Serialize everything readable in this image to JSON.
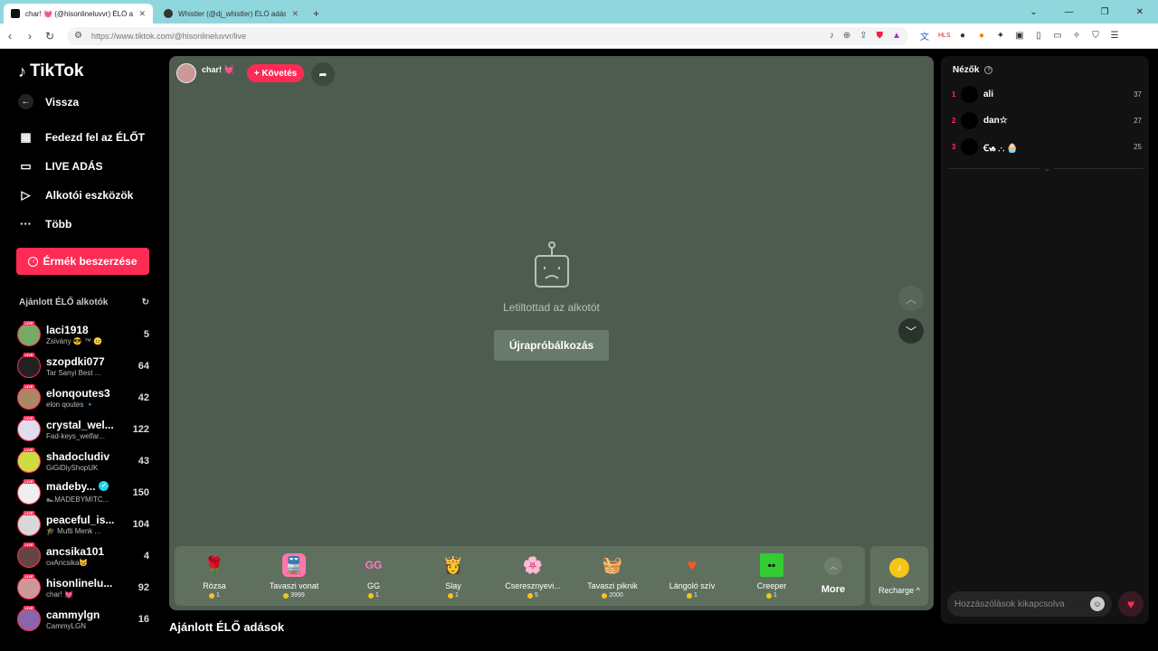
{
  "browser": {
    "tabs": [
      {
        "title": "char! 💓 (@hisonlineluvvr) ÉLŐ a...",
        "active": true
      },
      {
        "title": "Whistler (@dj_whistler) ÉLŐ adásban",
        "active": false
      }
    ],
    "url": "https://www.tiktok.com/@hisonlineluvvr/live"
  },
  "sidebar": {
    "logo": "TikTok",
    "back": "Vissza",
    "nav": [
      "Fedezd fel az ÉLŐT",
      "LIVE ADÁS",
      "Alkotói eszközök",
      "Több"
    ],
    "coins_button": "Érmék beszerzése",
    "recommended_title": "Ajánlott ÉLŐ alkotók",
    "live_badge": "LIVE",
    "creators": [
      {
        "name": "laci1918",
        "sub": "Zsivány 😎 ™ 😐",
        "count": "5",
        "verified": false
      },
      {
        "name": "szopdki077",
        "sub": "Tar Sanyi Best ...",
        "count": "64",
        "verified": false
      },
      {
        "name": "elonqoutes3",
        "sub": "elon qoutes 🔹",
        "count": "42",
        "verified": false
      },
      {
        "name": "crystal_wel...",
        "sub": "Fad-keys_welfar...",
        "count": "122",
        "verified": false
      },
      {
        "name": "shadocludiv",
        "sub": "GiGiDiyShopUK",
        "count": "43",
        "verified": false
      },
      {
        "name": "madeby...",
        "sub": "๛MADEBYMITC...",
        "count": "150",
        "verified": true
      },
      {
        "name": "peaceful_is...",
        "sub": "🎓 Mufti Menk ...",
        "count": "104",
        "verified": false
      },
      {
        "name": "ancsika101",
        "sub": "снАncsika😼",
        "count": "4",
        "verified": false
      },
      {
        "name": "hisonlinelu...",
        "sub": "char! 💓",
        "count": "92",
        "verified": false
      },
      {
        "name": "cammylgn",
        "sub": "CammyLGN",
        "count": "16",
        "verified": false
      }
    ]
  },
  "stream": {
    "host_name": "char! 💓",
    "follow": "+ Követés",
    "error_text": "Letiltottad az alkotót",
    "retry": "Újrapróbálkozás",
    "gifts": [
      {
        "name": "Rózsa",
        "price": "1",
        "icon": "🌹"
      },
      {
        "name": "Tavaszi vonat",
        "price": "3999",
        "icon": "🚆"
      },
      {
        "name": "GG",
        "price": "1",
        "icon": "GG"
      },
      {
        "name": "Slay",
        "price": "1",
        "icon": "👸"
      },
      {
        "name": "Cseresznyevi...",
        "price": "5",
        "icon": "🌸"
      },
      {
        "name": "Tavaszi piknik",
        "price": "2000",
        "icon": "🧺"
      },
      {
        "name": "Lángoló szív",
        "price": "1",
        "icon": "❤️"
      },
      {
        "name": "Creeper",
        "price": "1",
        "icon": "👾"
      }
    ],
    "more": "More",
    "recharge": "Recharge ^"
  },
  "recommended_broadcasts": "Ajánlott ÉLŐ adások",
  "viewers": {
    "title": "Nézők",
    "list": [
      {
        "rank": "1",
        "name": "ali",
        "score": "37"
      },
      {
        "rank": "2",
        "name": "dan☆",
        "score": "27"
      },
      {
        "rank": "3",
        "name": "Ꞓᏹ ⸫ 🧁",
        "score": "25"
      }
    ],
    "comment_placeholder": "Hozzászólások kikapcsolva"
  }
}
